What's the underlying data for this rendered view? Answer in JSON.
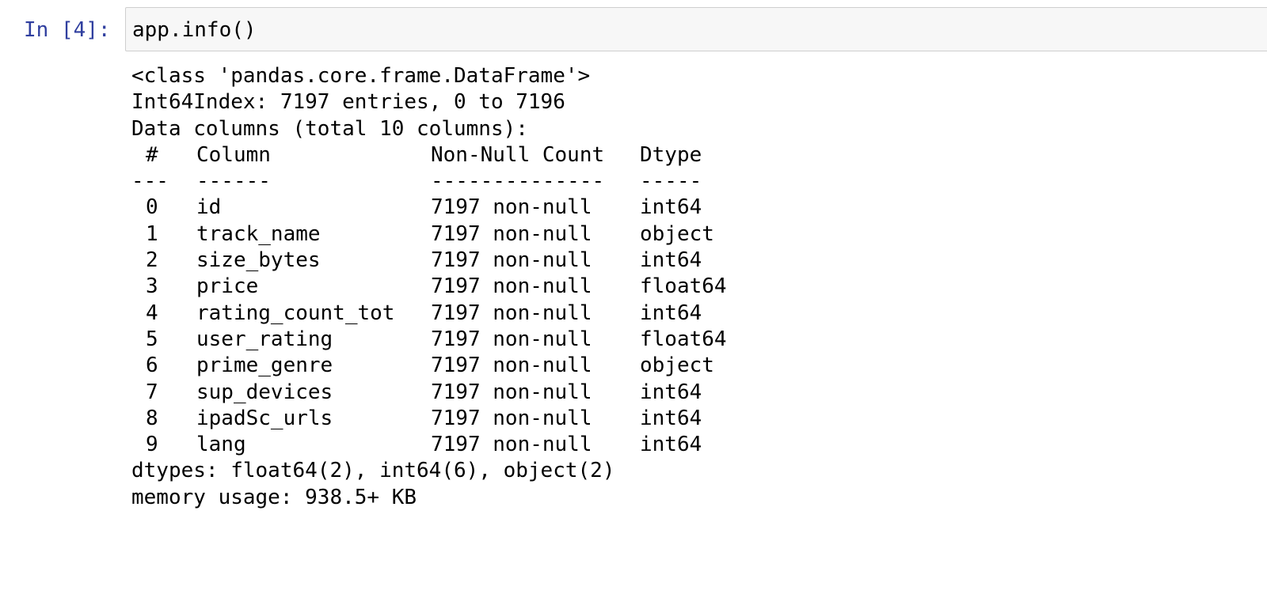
{
  "cell": {
    "prompt": "In [4]:",
    "code": "app.info()"
  },
  "output": {
    "class_line": "<class 'pandas.core.frame.DataFrame'>",
    "index_line": "Int64Index: 7197 entries, 0 to 7196",
    "columns_line": "Data columns (total 10 columns):",
    "header": {
      "num": "#",
      "column": "Column",
      "count": "Non-Null Count",
      "dtype": "Dtype"
    },
    "separator": {
      "num": "---",
      "column": "------",
      "count": "--------------",
      "dtype": "-----"
    },
    "rows": [
      {
        "num": "0",
        "column": "id",
        "count": "7197 non-null",
        "dtype": "int64"
      },
      {
        "num": "1",
        "column": "track_name",
        "count": "7197 non-null",
        "dtype": "object"
      },
      {
        "num": "2",
        "column": "size_bytes",
        "count": "7197 non-null",
        "dtype": "int64"
      },
      {
        "num": "3",
        "column": "price",
        "count": "7197 non-null",
        "dtype": "float64"
      },
      {
        "num": "4",
        "column": "rating_count_tot",
        "count": "7197 non-null",
        "dtype": "int64"
      },
      {
        "num": "5",
        "column": "user_rating",
        "count": "7197 non-null",
        "dtype": "float64"
      },
      {
        "num": "6",
        "column": "prime_genre",
        "count": "7197 non-null",
        "dtype": "object"
      },
      {
        "num": "7",
        "column": "sup_devices",
        "count": "7197 non-null",
        "dtype": "int64"
      },
      {
        "num": "8",
        "column": "ipadSc_urls",
        "count": "7197 non-null",
        "dtype": "int64"
      },
      {
        "num": "9",
        "column": "lang",
        "count": "7197 non-null",
        "dtype": "int64"
      }
    ],
    "dtypes_line": "dtypes: float64(2), int64(6), object(2)",
    "memory_line": "memory usage: 938.5+ KB"
  },
  "colors": {
    "prompt": "#303F9F",
    "input_bg": "#f7f7f7",
    "input_border": "#cfcfcf"
  }
}
